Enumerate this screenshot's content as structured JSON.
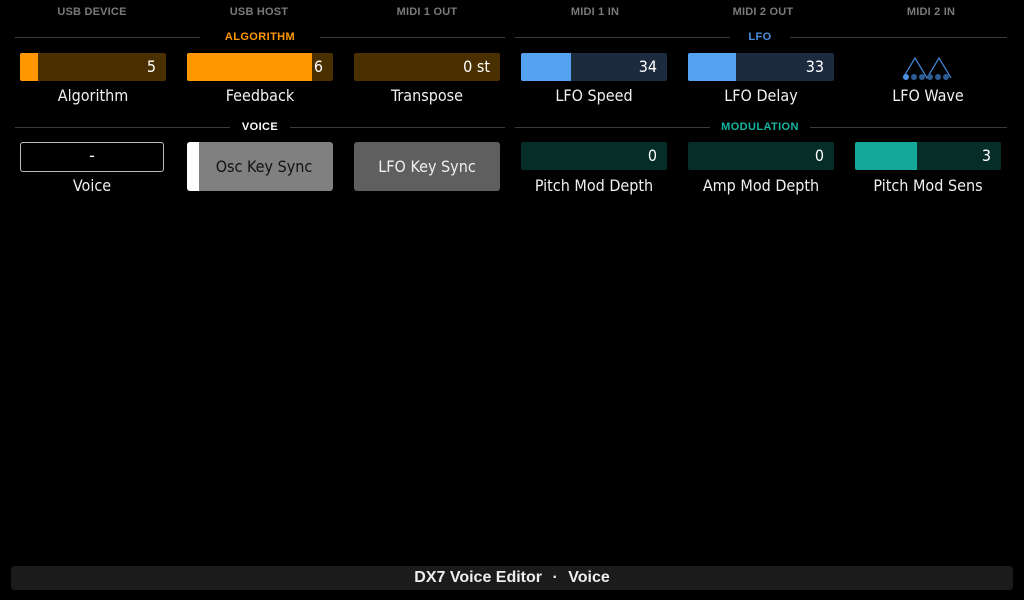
{
  "ports": [
    "USB DEVICE",
    "USB HOST",
    "MIDI 1 OUT",
    "MIDI 1 IN",
    "MIDI 2 OUT",
    "MIDI 2 IN"
  ],
  "sections": {
    "algorithm": {
      "title": "ALGORITHM",
      "color": "#ff9800"
    },
    "lfo": {
      "title": "LFO",
      "color": "#4a90e2"
    },
    "voice": {
      "title": "VOICE",
      "color": "#ffffff"
    },
    "modulation": {
      "title": "MODULATION",
      "color": "#13b5a0"
    }
  },
  "controls": {
    "algorithm": {
      "label": "Algorithm",
      "value": "5",
      "fill_fraction": 0.12
    },
    "feedback": {
      "label": "Feedback",
      "value": "6",
      "fill_fraction": 0.85
    },
    "transpose": {
      "label": "Transpose",
      "value": "0 st",
      "fill_fraction": 0.0
    },
    "lfo_speed": {
      "label": "LFO Speed",
      "value": "34",
      "fill_fraction": 0.34
    },
    "lfo_delay": {
      "label": "LFO Delay",
      "value": "33",
      "fill_fraction": 0.33
    },
    "lfo_wave": {
      "label": "LFO Wave",
      "icon": "triangle-wave-icon"
    },
    "voice": {
      "label": "Voice",
      "value": "-"
    },
    "osc_key_sync": {
      "label": "Osc Key Sync",
      "state": "on"
    },
    "lfo_key_sync": {
      "label": "LFO Key Sync",
      "state": "off"
    },
    "pitch_mod_depth": {
      "label": "Pitch Mod Depth",
      "value": "0",
      "fill_fraction": 0.0
    },
    "amp_mod_depth": {
      "label": "Amp Mod Depth",
      "value": "0",
      "fill_fraction": 0.0
    },
    "pitch_mod_sens": {
      "label": "Pitch Mod Sens",
      "value": "3",
      "fill_fraction": 0.43
    }
  },
  "footer": {
    "app": "DX7 Voice Editor",
    "separator": "·",
    "page": "Voice"
  },
  "colors": {
    "orange": "#ff9800",
    "orange_track": "#4a3000",
    "blue": "#55a3f0",
    "blue_track": "#1c2b3e",
    "teal": "#13a899",
    "teal_track": "#062e28",
    "toggle_gray": "#808080",
    "toggle_gray_dark": "#5f5f5f"
  }
}
